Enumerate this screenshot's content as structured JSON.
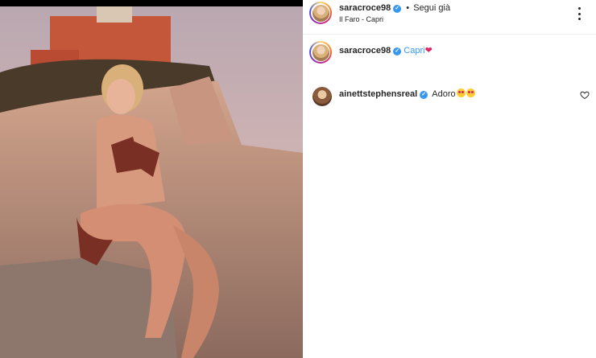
{
  "post": {
    "author": "saracroce98",
    "follow_label": "Segui già",
    "separator": "•",
    "location": "Il Faro - Capri",
    "caption_user": "saracroce98",
    "caption_text": "Capri",
    "caption_emoji": "❤"
  },
  "comments": [
    {
      "user": "ainettstephensreal",
      "text": "Adoro"
    }
  ],
  "icons": {
    "verified": "verified-badge-icon",
    "more": "more-options-icon",
    "like": "heart-outline-icon"
  },
  "colors": {
    "verified_blue": "#3897f0",
    "text": "#262626"
  }
}
